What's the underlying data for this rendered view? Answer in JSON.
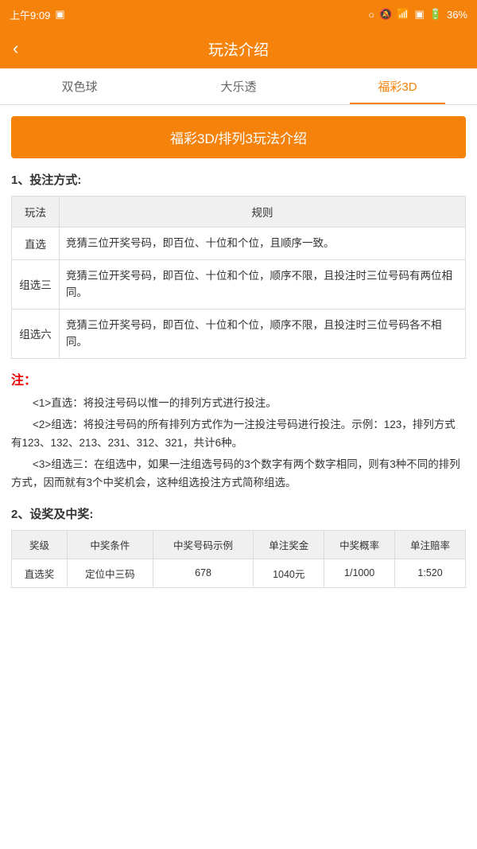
{
  "statusBar": {
    "time": "上午9:09",
    "battery": "36%"
  },
  "header": {
    "title": "玩法介绍",
    "backLabel": "‹"
  },
  "tabs": [
    {
      "id": "tab1",
      "label": "双色球",
      "active": false
    },
    {
      "id": "tab2",
      "label": "大乐透",
      "active": false
    },
    {
      "id": "tab3",
      "label": "福彩3D",
      "active": true
    }
  ],
  "banner": {
    "text": "福彩3D/排列3玩法介绍"
  },
  "section1": {
    "heading": "1、投注方式:",
    "tableHeaders": [
      "玩法",
      "规则"
    ],
    "tableRows": [
      {
        "name": "直选",
        "rule": "竞猜三位开奖号码，即百位、十位和个位，且顺序一致。"
      },
      {
        "name": "组选三",
        "rule": "竞猜三位开奖号码，即百位、十位和个位，顺序不限，且投注时三位号码有两位相同。"
      },
      {
        "name": "组选六",
        "rule": "竞猜三位开奖号码，即百位、十位和个位，顺序不限，且投注时三位号码各不相同。"
      }
    ]
  },
  "notes": {
    "title": "注：",
    "items": [
      "<1>直选：将投注号码以惟一的排列方式进行投注。",
      "<2>组选：将投注号码的所有排列方式作为一注投注号码进行投注。示例：123，排列方式有123、132、213、231、312、321，共计6种。",
      "<3>组选三：在组选中，如果一注组选号码的3个数字有两个数字相同，则有3种不同的排列方式，因而就有3个中奖机会，这种组选投注方式简称组选。"
    ]
  },
  "section2": {
    "heading": "2、设奖及中奖:",
    "tableHeaders": [
      "奖级",
      "中奖条件",
      "中奖号码示例",
      "单注奖金",
      "中奖概率",
      "单注赔率"
    ],
    "tableRows": [
      {
        "level": "直选奖",
        "condition": "定位中三码",
        "example": "678",
        "prize": "1040元",
        "probability": "1/1000",
        "odds": "1:520"
      }
    ]
  }
}
